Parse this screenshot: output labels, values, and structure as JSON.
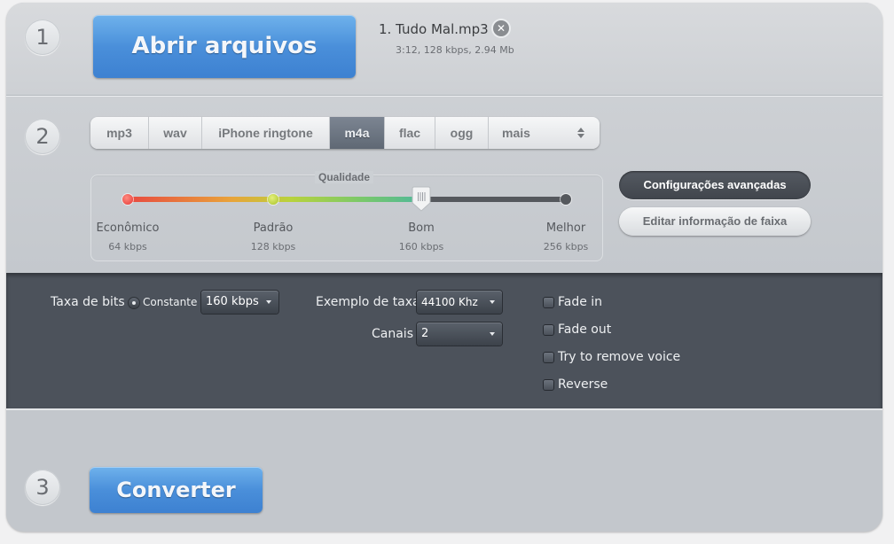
{
  "step1": {
    "number": "1",
    "open_button": "Abrir arquivos",
    "file": {
      "name": "1. Tudo Mal.mp3",
      "meta": "3:12, 128 kbps, 2.94 Mb",
      "remove_icon": "close-circle-icon"
    }
  },
  "step2": {
    "number": "2",
    "formats": [
      "mp3",
      "wav",
      "iPhone ringtone",
      "m4a",
      "flac",
      "ogg",
      "mais"
    ],
    "selected_format": "m4a",
    "more_icon": "up-down-arrows-icon",
    "quality": {
      "title": "Qualidade",
      "selected_index": 2,
      "levels": [
        {
          "label": "Econômico",
          "sub": "64 kbps"
        },
        {
          "label": "Padrão",
          "sub": "128 kbps"
        },
        {
          "label": "Bom",
          "sub": "160 kbps"
        },
        {
          "label": "Melhor",
          "sub": "256 kbps"
        }
      ]
    },
    "advanced_button": "Configurações avançadas",
    "edit_info_button": "Editar informação de faixa"
  },
  "advanced": {
    "bitrate_label": "Taxa de bits",
    "bitrate_mode": "Constante",
    "bitrate_value": "160 kbps",
    "sample_rate_label": "Exemplo de taxa",
    "sample_rate_value": "44100 Khz",
    "channels_label": "Canais",
    "channels_value": "2",
    "checkboxes": [
      {
        "label": "Fade in",
        "checked": false
      },
      {
        "label": "Fade out",
        "checked": false
      },
      {
        "label": "Try to remove voice",
        "checked": false
      },
      {
        "label": "Reverse",
        "checked": false
      }
    ]
  },
  "step3": {
    "number": "3",
    "convert_button": "Converter"
  }
}
